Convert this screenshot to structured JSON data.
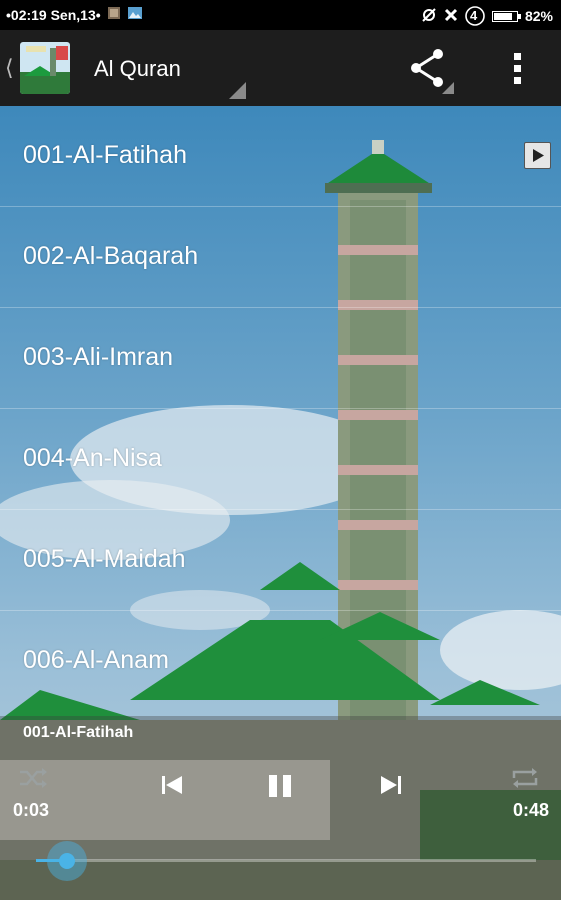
{
  "status_bar": {
    "time": "•02:19 Sen,13•",
    "battery_percent": "82%",
    "battery_level": 0.82,
    "network_label": "4",
    "icons": [
      "gallery-icon",
      "image-icon",
      "no-sync-icon",
      "no-signal-icon",
      "network-4g-icon",
      "battery-icon"
    ]
  },
  "action_bar": {
    "title": "Al Quran",
    "icons": [
      "up-caret-icon",
      "app-icon",
      "share-icon",
      "overflow-menu-icon"
    ]
  },
  "surahs": [
    {
      "label": "001-Al-Fatihah"
    },
    {
      "label": "002-Al-Baqarah"
    },
    {
      "label": "003-Ali-Imran"
    },
    {
      "label": "004-An-Nisa"
    },
    {
      "label": "005-Al-Maidah"
    },
    {
      "label": "006-Al-Anam"
    }
  ],
  "player": {
    "now_playing": "001-Al-Fatihah",
    "elapsed": "0:03",
    "duration": "0:48",
    "progress": 0.0625,
    "controls": [
      "shuffle-icon",
      "previous-icon",
      "pause-icon",
      "next-icon",
      "repeat-icon"
    ]
  },
  "colors": {
    "accent": "#4ab3e6",
    "action_bar": "#1d1d1d",
    "dome": "#1f8a3a"
  }
}
